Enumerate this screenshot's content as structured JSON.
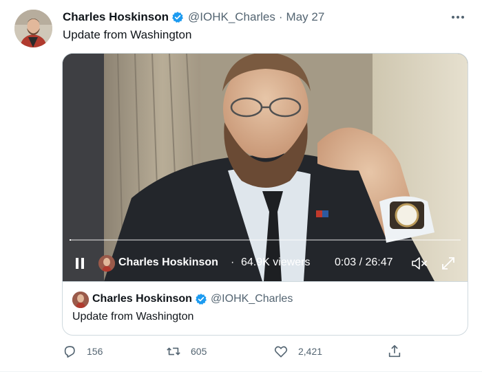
{
  "tweet": {
    "author_name": "Charles Hoskinson",
    "handle": "@IOHK_Charles",
    "separator": "·",
    "date": "May 27",
    "text": "Update from Washington",
    "verified": true
  },
  "media": {
    "type": "broadcast-video",
    "host_name": "Charles Hoskinson",
    "separator": "·",
    "viewers": "64.9K viewers",
    "time": "0:03 / 26:47",
    "progress_fraction": 0.002,
    "state": "playing"
  },
  "quote_card": {
    "name": "Charles Hoskinson",
    "handle": "@IOHK_Charles",
    "text": "Update from Washington"
  },
  "actions": {
    "replies": "156",
    "retweets": "605",
    "likes": "2,421"
  },
  "icons": {
    "more": "more-icon",
    "verified": "verified-badge-icon",
    "pause": "pause-icon",
    "mute": "mute-icon",
    "fullscreen": "fullscreen-icon",
    "reply": "reply-icon",
    "retweet": "retweet-icon",
    "like": "heart-icon",
    "share": "share-icon"
  },
  "colors": {
    "verified_blue": "#1d9bf0",
    "secondary_text": "#536471",
    "primary_text": "#0f1419",
    "border": "#cfd9de"
  }
}
